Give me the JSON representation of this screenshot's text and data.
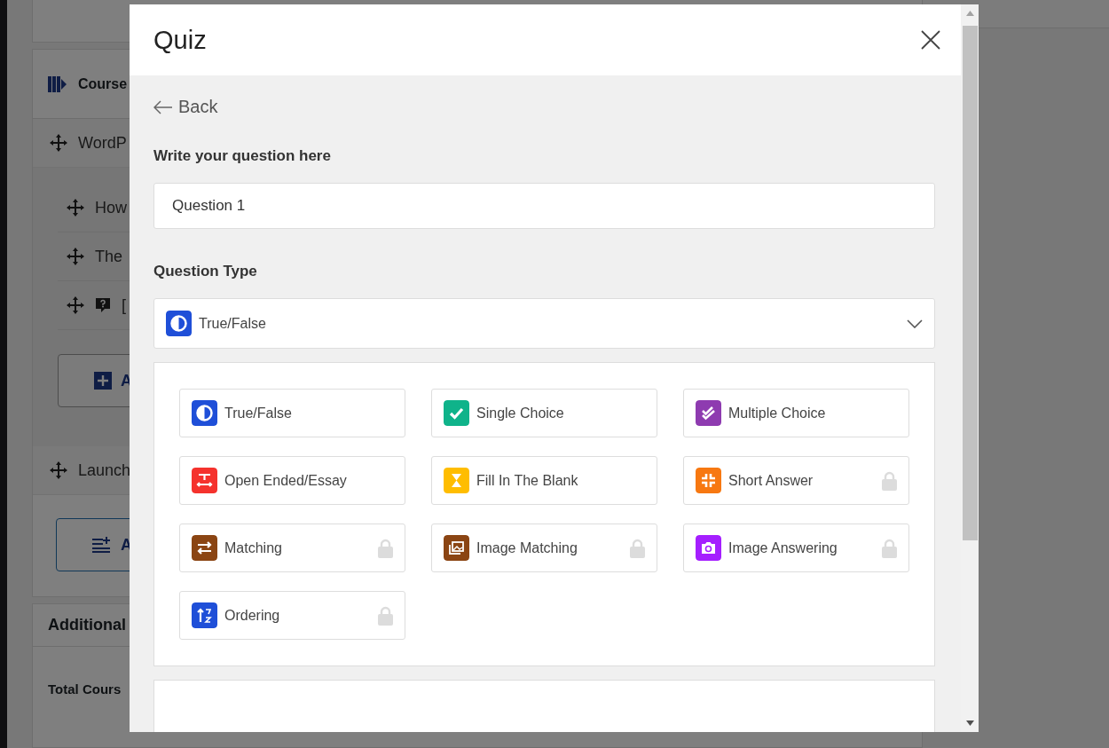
{
  "background_page": {
    "course_header": "Course",
    "topics": [
      {
        "title": "WordP",
        "lessons": [
          {
            "kind": "lesson",
            "title": "How"
          },
          {
            "kind": "lesson",
            "title": "The"
          },
          {
            "kind": "quiz",
            "title": "["
          }
        ],
        "add_button": {
          "kind": "plus",
          "label": "A"
        }
      },
      {
        "title": "Launch",
        "add_button": {
          "kind": "list",
          "label": "A"
        }
      }
    ],
    "additional": {
      "title": "Additional",
      "rows": [
        "Total Cours"
      ]
    }
  },
  "modal": {
    "title": "Quiz",
    "back": "Back",
    "question_label": "Write your question here",
    "question_value": "Question 1",
    "type_label": "Question Type",
    "type_select": {
      "kind": "truefalse",
      "color": "#1f4fd8",
      "value": "True/False"
    },
    "type_options": [
      {
        "kind": "truefalse",
        "label": "True/False",
        "color": "#1f4fd8",
        "locked": false
      },
      {
        "kind": "single",
        "label": "Single Choice",
        "color": "#0fb38a",
        "locked": false
      },
      {
        "kind": "multiple",
        "label": "Multiple Choice",
        "color": "#8e3bb0",
        "locked": false
      },
      {
        "kind": "essay",
        "label": "Open Ended/Essay",
        "color": "#f5322d",
        "locked": false
      },
      {
        "kind": "blank",
        "label": "Fill In The Blank",
        "color": "#ffbd00",
        "locked": false
      },
      {
        "kind": "short",
        "label": "Short Answer",
        "color": "#f77811",
        "locked": true
      },
      {
        "kind": "matching",
        "label": "Matching",
        "color": "#8b4513",
        "locked": true
      },
      {
        "kind": "image_matching",
        "label": "Image Matching",
        "color": "#8b4513",
        "locked": true
      },
      {
        "kind": "image_answering",
        "label": "Image Answering",
        "color": "#a51fff",
        "locked": true
      },
      {
        "kind": "ordering",
        "label": "Ordering",
        "color": "#1f4fd8",
        "locked": true
      }
    ]
  }
}
